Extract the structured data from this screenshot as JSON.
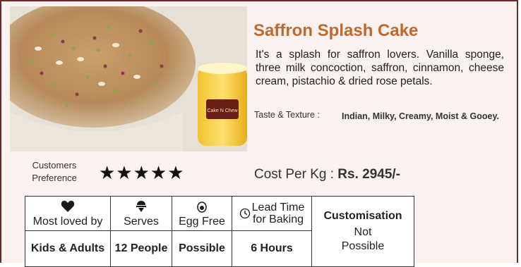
{
  "product": {
    "title": "Saffron Splash Cake",
    "description": "It's a splash for saffron lovers. Vanilla sponge, three milk concoction, saffron, cinnamon, cheese cream, pistachio & dried rose petals.",
    "taste_label": "Taste &  Texture :",
    "taste_value": "Indian, Milky, Creamy, Moist & Gooey.",
    "jar_label": "Cake N Chew"
  },
  "rating": {
    "label_line1": "Customers",
    "label_line2": "Preference",
    "stars": "★★★★★",
    "value": 5,
    "max": 5
  },
  "cost": {
    "label": "Cost Per Kg : ",
    "price": "Rs. 2945/-"
  },
  "info": {
    "headers": {
      "loved": "Most loved by",
      "serves": "Serves",
      "egg": "Egg Free",
      "lead_line1": "Lead Time",
      "lead_line2": "for Baking",
      "custom": "Customisation"
    },
    "values": {
      "loved": "Kids & Adults",
      "serves": "12 People",
      "egg": "Possible",
      "lead": "6 Hours",
      "custom_line1": "Not",
      "custom_line2": "Possible"
    },
    "icons": {
      "loved": "heart-icon",
      "serves": "cake-slice-icon",
      "egg": "egg-icon",
      "lead": "clock-icon"
    }
  },
  "colors": {
    "title": "#c0692f",
    "border": "#6b2a2a",
    "background": "#fbf1ee"
  }
}
